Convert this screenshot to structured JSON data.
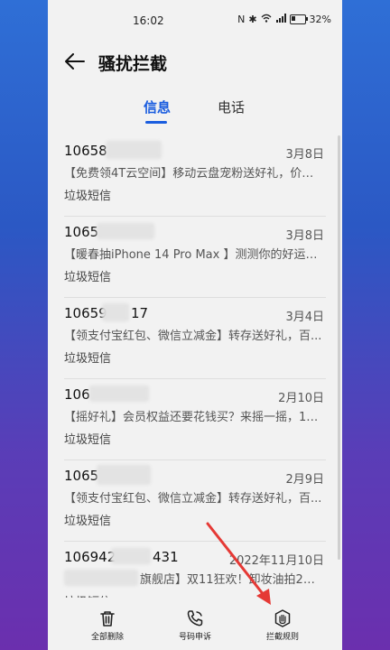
{
  "status": {
    "time": "16:02",
    "battery": "32%"
  },
  "header": {
    "title": "骚扰拦截"
  },
  "tabs": [
    {
      "label": "信息",
      "active": true
    },
    {
      "label": "电话",
      "active": false
    }
  ],
  "messages": [
    {
      "number": "10658",
      "date": "3月8日",
      "preview": "【免费领4T云空间】移动云盘宠粉送好礼，价值...",
      "type": "垃圾短信"
    },
    {
      "number": "1065",
      "date": "3月8日",
      "preview": "【暖春抽iPhone 14 Pro Max 】测测你的好运气...",
      "type": "垃圾短信"
    },
    {
      "number": "10659",
      "number_suffix": "17",
      "date": "3月4日",
      "preview": "【领支付宝红包、微信立减金】转存送好礼，百...",
      "type": "垃圾短信"
    },
    {
      "number": "106",
      "date": "2月10日",
      "preview": "【摇好礼】会员权益还要花钱买？来摇一摇，10...",
      "type": "垃圾短信"
    },
    {
      "number": "1065",
      "date": "2月9日",
      "preview": "【领支付宝红包、微信立减金】转存送好礼，百...",
      "type": "垃圾短信"
    },
    {
      "number": "106942",
      "number_suffix": "431",
      "date": "2022年11月10日",
      "preview": "旗舰店】双11狂欢！卸妆油拍2到手...",
      "type": "垃圾短信"
    }
  ],
  "bottom_bar": {
    "delete_all": "全部删除",
    "appeal": "号码申诉",
    "rules": "拦截规则"
  },
  "colors": {
    "accent": "#1a5ddf",
    "arrow": "#e53935"
  }
}
